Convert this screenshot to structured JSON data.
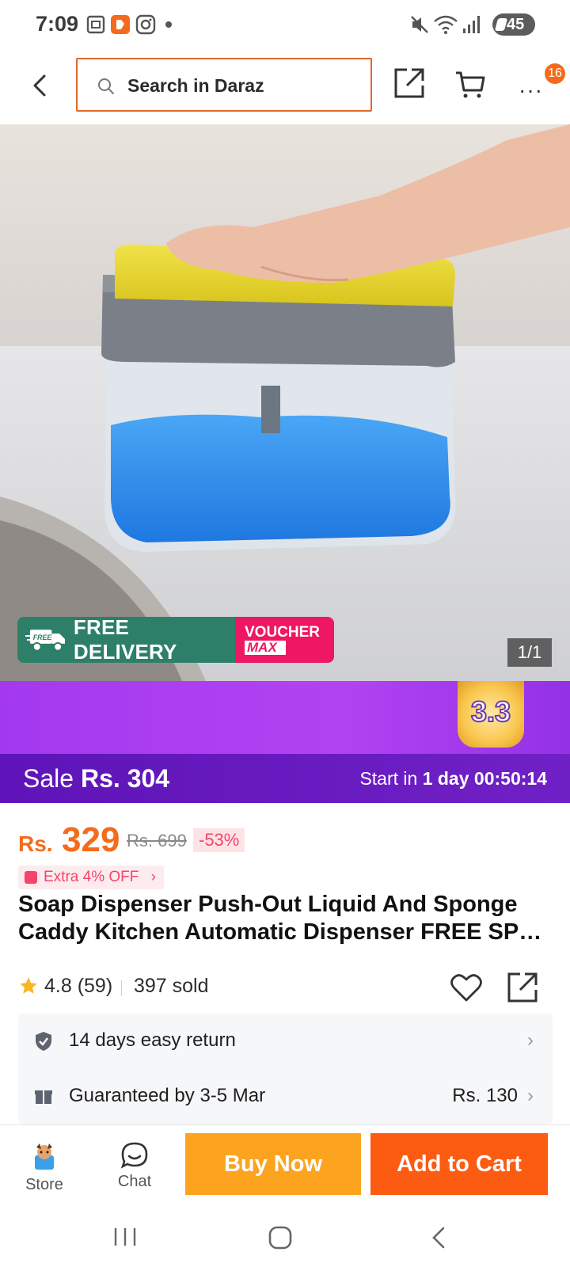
{
  "status_bar": {
    "time": "7:09",
    "battery": "45",
    "icons": [
      "screenshot-icon",
      "app-icon",
      "instagram-icon",
      "dot-icon",
      "mute-icon",
      "wifi-icon",
      "signal-icon"
    ]
  },
  "header": {
    "search_placeholder": "Search in Daraz",
    "more_badge": "16",
    "accent_color": "#e0672a"
  },
  "product_image": {
    "counter": "1/1",
    "free_delivery_tag": "FREE",
    "free_delivery": "FREE DELIVERY",
    "voucher_line1": "VOUCHER",
    "voucher_line2": "MAX"
  },
  "campaign": {
    "badge": "3.3",
    "sale_label": "Sale",
    "sale_price": "Rs. 304",
    "countdown_prefix": "Start in",
    "countdown_days": "1 day",
    "countdown_time": "00:50:14"
  },
  "pricing": {
    "currency": "Rs.",
    "price": "329",
    "original_price": "Rs. 699",
    "discount": "-53%",
    "extra_off": "Extra 4% OFF",
    "price_color": "#f36b1c"
  },
  "product": {
    "title_line1": "Soap Dispenser Push-Out Liquid And Sponge",
    "title_line2": "Caddy Kitchen Automatic Dispenser FREE SPO...",
    "rating": "4.8 (59)",
    "sold": "397 sold"
  },
  "info": {
    "return_policy": "14 days easy return",
    "delivery": "Guaranteed by 3-5 Mar",
    "delivery_fee": "Rs. 130"
  },
  "bottom_bar": {
    "store_label": "Store",
    "chat_label": "Chat",
    "buy_now": "Buy Now",
    "add_to_cart": "Add to Cart"
  }
}
